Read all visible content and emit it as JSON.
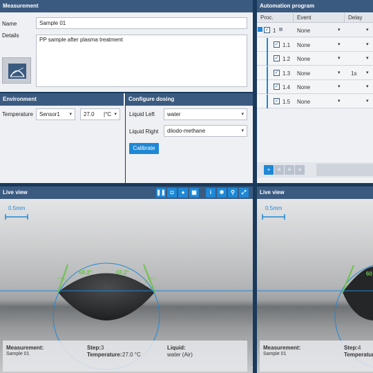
{
  "measurement": {
    "header": "Measurement",
    "name_label": "Name",
    "name_value": "Sample 01",
    "details_label": "Details",
    "details_value": "PP sample after plasma treatment"
  },
  "environment": {
    "header": "Environment",
    "temperature_label": "Temperature",
    "sensor_value": "Sensor1",
    "temp_value": "27.0",
    "unit_value": "|°C"
  },
  "dosing": {
    "header": "Configure dosing",
    "liquid_left_label": "Liquid Left",
    "liquid_left_value": "water",
    "liquid_right_label": "Liquid Right",
    "liquid_right_value": "diiodo-methane",
    "calibrate_label": "Calibrate"
  },
  "automation": {
    "header": "Automation program",
    "col_proc": "Proc.",
    "col_event": "Event",
    "col_delay": "Delay",
    "rows": [
      {
        "proc": "1",
        "event": "None",
        "delay": ""
      },
      {
        "proc": "1.1",
        "event": "None",
        "delay": ""
      },
      {
        "proc": "1.2",
        "event": "None",
        "delay": ""
      },
      {
        "proc": "1.3",
        "event": "None",
        "delay": "1s"
      },
      {
        "proc": "1.4",
        "event": "None",
        "delay": ""
      },
      {
        "proc": "1.5",
        "event": "None",
        "delay": ""
      }
    ]
  },
  "live_left": {
    "header": "Live view",
    "scale": "0.5mm",
    "angle_left": "68.3°",
    "angle_right": "68.2°",
    "info": {
      "measurement_label": "Measurement:",
      "measurement_value": "Sample 01",
      "step_label": "Step:",
      "step_value": "3",
      "temp_label": "Temperature:",
      "temp_value": "27.0 °C",
      "liquid_label": "Liquid:",
      "liquid_value": "water (Air)"
    }
  },
  "live_right": {
    "header": "Live view",
    "scale": "0.5mm",
    "angle_left": "60",
    "info": {
      "measurement_label": "Measurement:",
      "measurement_value": "Sample 01",
      "step_label": "Step:",
      "step_value": "4",
      "temp_label": "Temperature"
    }
  },
  "colors": {
    "header": "#3b5a80",
    "accent": "#1e88d6",
    "angle": "#6cc24a"
  }
}
